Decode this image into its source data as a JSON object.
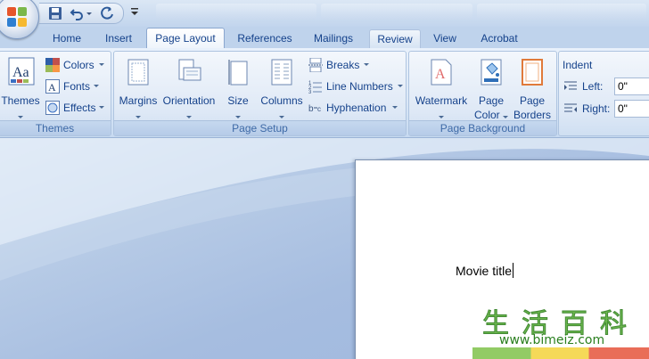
{
  "tabs": [
    {
      "label": "Home"
    },
    {
      "label": "Insert"
    },
    {
      "label": "Page Layout"
    },
    {
      "label": "References"
    },
    {
      "label": "Mailings"
    },
    {
      "label": "Review"
    },
    {
      "label": "View"
    },
    {
      "label": "Acrobat"
    }
  ],
  "active_tab": "Page Layout",
  "groups": {
    "themes": {
      "label": "Themes",
      "themes_button": "Themes",
      "colors": "Colors",
      "fonts": "Fonts",
      "effects": "Effects"
    },
    "page_setup": {
      "label": "Page Setup",
      "margins": "Margins",
      "orientation": "Orientation",
      "size": "Size",
      "columns": "Columns",
      "breaks": "Breaks",
      "line_numbers": "Line Numbers",
      "hyphenation": "Hyphenation"
    },
    "page_background": {
      "label": "Page Background",
      "watermark": "Watermark",
      "page_color_1": "Page",
      "page_color_2": "Color",
      "page_borders_1": "Page",
      "page_borders_2": "Borders"
    },
    "paragraph": {
      "indent": "Indent",
      "left_label": "Left:",
      "left_value": "0\"",
      "right_label": "Right:",
      "right_value": "0\""
    }
  },
  "document": {
    "text": "Movie title"
  },
  "watermark": {
    "chinese": "生活百科",
    "url": "www.bimeiz.com"
  },
  "colors": {
    "ribbon": "#dbe8f7",
    "tab_text": "#15428b",
    "accent_green": "#5cb03a"
  }
}
